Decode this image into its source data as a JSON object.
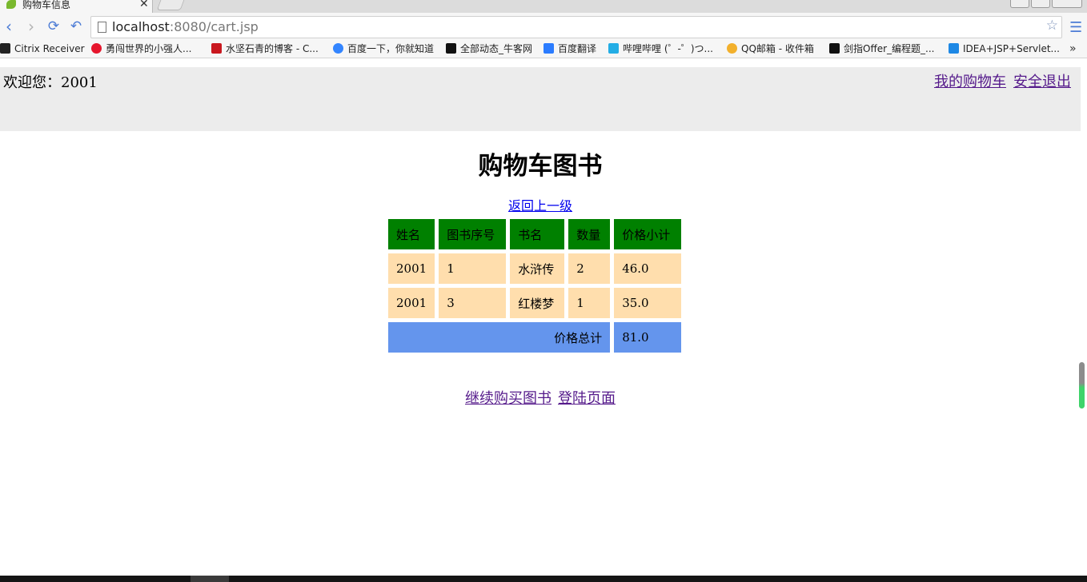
{
  "browser": {
    "tab_title": "购物车信息",
    "url_host": "localhost",
    "url_rest": ":8080/cart.jsp",
    "bookmarks": [
      {
        "label": "Citrix Receiver",
        "icon": "citrix-icon",
        "color": "#222222"
      },
      {
        "label": "勇闯世界的小强人...",
        "icon": "weibo-icon",
        "color": "#e6162d"
      },
      {
        "label": "水坚石青的博客 - C...",
        "icon": "csdn-icon",
        "color": "#c9181f"
      },
      {
        "label": "百度一下，你就知道",
        "icon": "baidu-paw-icon",
        "color": "#3385ff"
      },
      {
        "label": "全部动态_牛客网",
        "icon": "nowcoder-icon",
        "color": "#111111"
      },
      {
        "label": "百度翻译",
        "icon": "baidu-translate-icon",
        "color": "#2b7cff"
      },
      {
        "label": "哔哩哔哩 (゜-゜)つ...",
        "icon": "bilibili-icon",
        "color": "#23ade5"
      },
      {
        "label": "QQ邮箱 - 收件箱",
        "icon": "chrome-app-icon",
        "color": "#f2b02c"
      },
      {
        "label": "剑指Offer_编程题_...",
        "icon": "nowcoder-icon",
        "color": "#111111"
      },
      {
        "label": "IDEA+JSP+Servlet...",
        "icon": "doc-icon",
        "color": "#1e88e5"
      }
    ],
    "overflow_label": "»"
  },
  "header": {
    "welcome": "欢迎您：2001",
    "my_cart": "我的购物车",
    "logout": "安全退出"
  },
  "main": {
    "title": "购物车图书",
    "back_link": "返回上一级",
    "columns": [
      "姓名",
      "图书序号",
      "书名",
      "数量",
      "价格小计"
    ],
    "rows": [
      [
        "2001",
        "1",
        "水浒传",
        "2",
        "46.0"
      ],
      [
        "2001",
        "3",
        "红楼梦",
        "1",
        "35.0"
      ]
    ],
    "total_label": "价格总计",
    "total_value": "81.0",
    "continue_link": "继续购买图书",
    "login_link": "登陆页面"
  },
  "colors": {
    "header_row": "#008000",
    "data_row": "#ffdead",
    "total_row": "#6495ed",
    "header_bar": "#ececec"
  }
}
